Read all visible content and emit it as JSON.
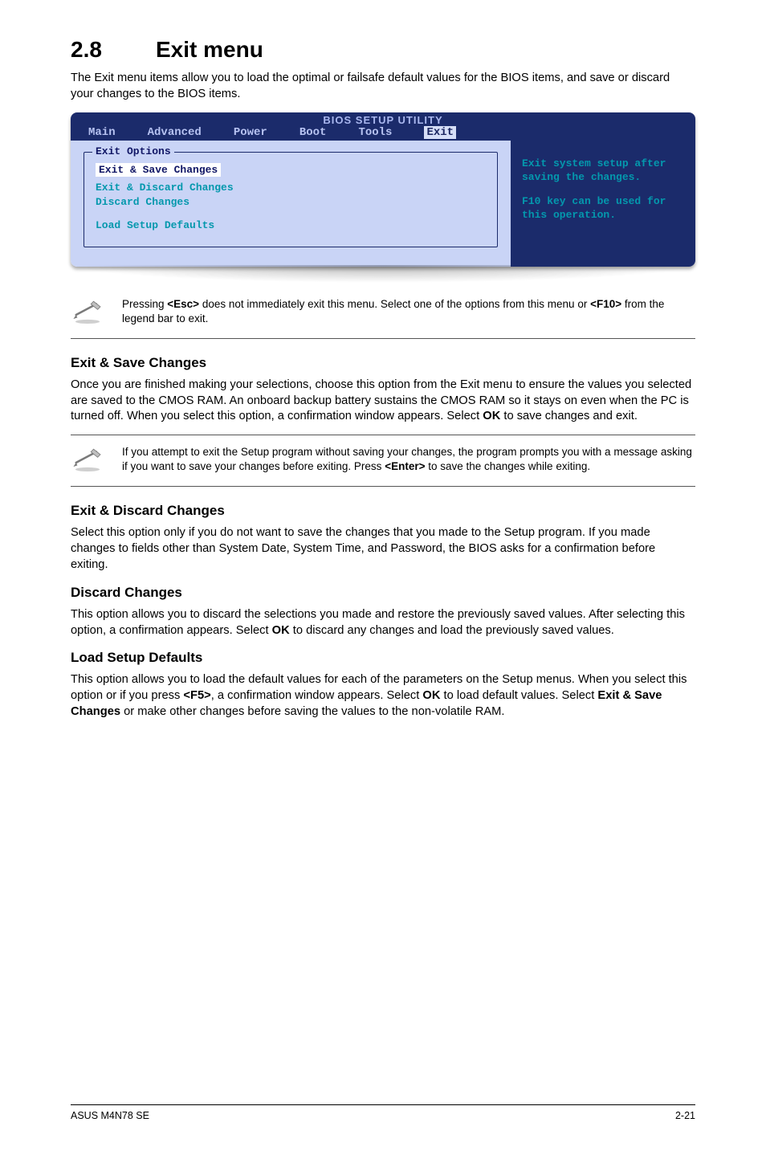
{
  "section": {
    "num": "2.8",
    "title": "Exit menu"
  },
  "intro": "The Exit menu items allow you to load the optimal or failsafe default values for the BIOS items, and save or discard your changes to the BIOS items.",
  "bios": {
    "title": "BIOS SETUP UTILITY",
    "tabs": [
      "Main",
      "Advanced",
      "Power",
      "Boot",
      "Tools",
      "Exit"
    ],
    "legend": "Exit Options",
    "items": [
      "Exit & Save Changes",
      "Exit & Discard Changes",
      "Discard Changes",
      "Load Setup Defaults"
    ],
    "help1": "Exit system setup after saving the changes.",
    "help2": "F10 key can be used for this operation."
  },
  "note_esc_pre": "Pressing ",
  "note_esc_key": "<Esc>",
  "note_esc_mid": " does not immediately exit this menu. Select one of the options from this menu or ",
  "note_esc_key2": "<F10>",
  "note_esc_post": " from the legend bar to exit.",
  "s1": {
    "h": "Exit & Save Changes",
    "p_pre": "Once you are finished making your selections, choose this option from the Exit menu to ensure the values you selected are saved to the CMOS RAM. An onboard backup battery sustains the CMOS RAM so it stays on even when the PC is turned off. When you select this option, a confirmation window appears. Select ",
    "p_bold": "OK",
    "p_post": " to save changes and exit."
  },
  "note_save_pre": " If you attempt to exit the Setup program without saving your changes, the program prompts you with a message asking if you want to save your changes before exiting. Press ",
  "note_save_key": "<Enter>",
  "note_save_post": " to save the  changes while exiting.",
  "s2": {
    "h": "Exit & Discard Changes",
    "p": "Select this option only if you do not want to save the changes that you  made to the Setup program. If you made changes to fields other than System Date, System Time, and Password, the BIOS asks for a confirmation before exiting."
  },
  "s3": {
    "h": "Discard Changes",
    "p_pre": "This option allows you to discard the selections you made and restore the previously saved values. After selecting this option, a confirmation appears. Select ",
    "p_bold": "OK",
    "p_post": " to discard any changes and load the previously saved values."
  },
  "s4": {
    "h": "Load Setup Defaults",
    "p_pre": "This option allows you to load the default values for each of the parameters on the Setup menus. When you select this option or if you press ",
    "p_bold1": "<F5>",
    "p_mid1": ", a confirmation window appears. Select ",
    "p_bold2": "OK",
    "p_mid2": " to load default values. Select ",
    "p_bold3": "Exit & Save Changes",
    "p_post": " or make other changes before saving the values to the non-volatile RAM."
  },
  "footer": {
    "left": "ASUS M4N78 SE",
    "right": "2-21"
  }
}
